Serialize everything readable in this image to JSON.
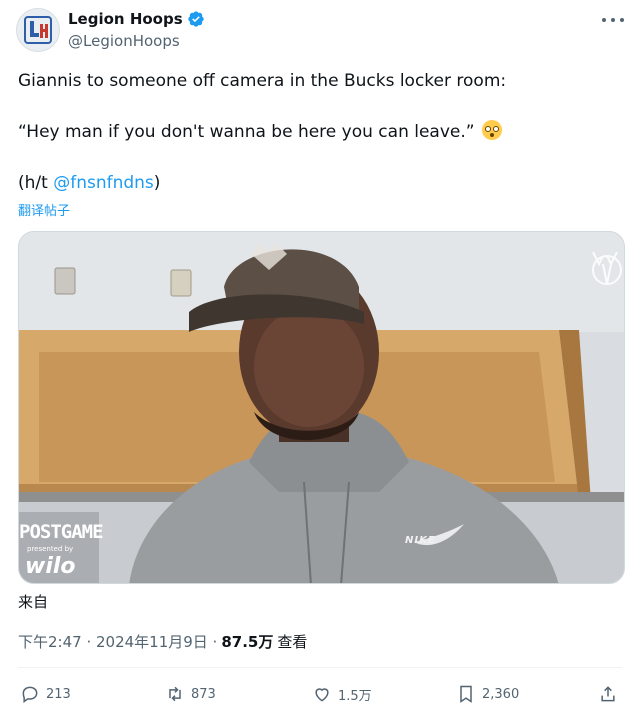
{
  "author": {
    "name": "Legion Hoops",
    "handle": "@LegionHoops"
  },
  "tweet": {
    "line1": "Giannis to someone off camera in the Bucks locker room:",
    "line2": "“Hey man if you don't wanna be here you can leave.”",
    "line3_prefix": "(h/t ",
    "line3_mention": "@fnsnfndns",
    "line3_suffix": ")",
    "emoji": "flushed-face",
    "translate_label": "翻译帖子"
  },
  "media": {
    "overlay_title": "POSTGAME",
    "overlay_presented": "presented by",
    "overlay_sponsor": "wilo",
    "hoodie_brand": "NIKE"
  },
  "source_label": "来自",
  "meta": {
    "time": "下午2:47 · 2024年11月9日 ·",
    "views": "87.5万",
    "views_label": "查看"
  },
  "actions": {
    "replies": "213",
    "reposts": "873",
    "likes": "1.5万",
    "bookmarks": "2,360"
  },
  "colors": {
    "accent": "#1d9bf0",
    "muted": "#536471",
    "repost_green": "#00ba7c",
    "verified_blue": "#1d9bf0"
  }
}
